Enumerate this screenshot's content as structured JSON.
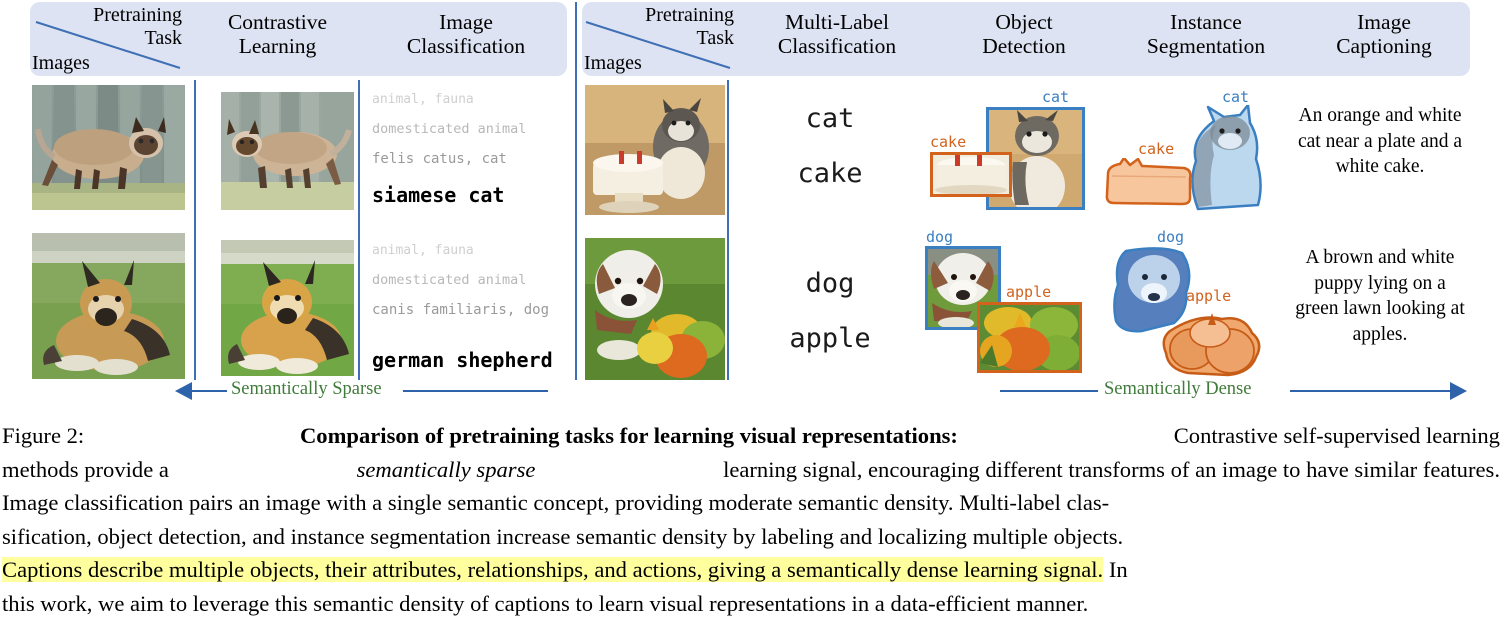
{
  "figure": {
    "label": "Figure 2:",
    "headers": {
      "left_panel": {
        "corner": {
          "task": "Pretraining Task",
          "task_l1": "Pretraining",
          "task_l2": "Task",
          "images": "Images"
        },
        "columns": [
          {
            "l1": "Contrastive",
            "l2": "Learning"
          },
          {
            "l1": "Image",
            "l2": "Classification"
          }
        ]
      },
      "right_panel": {
        "corner": {
          "task_l1": "Pretraining",
          "task_l2": "Task",
          "images": "Images"
        },
        "columns": [
          {
            "l1": "Multi-Label",
            "l2": "Classification"
          },
          {
            "l1": "Object",
            "l2": "Detection"
          },
          {
            "l1": "Instance",
            "l2": "Segmentation"
          },
          {
            "l1": "Image",
            "l2": "Captioning"
          }
        ]
      }
    },
    "rows": [
      {
        "id": "cat-row",
        "image_classification": {
          "hierarchy": [
            "animal, fauna",
            "domesticated animal",
            "felis catus, cat"
          ],
          "final_label": "siamese cat"
        },
        "multi_label": [
          "cat",
          "cake"
        ],
        "detection": [
          {
            "label": "cat",
            "color": "#3a7fc1"
          },
          {
            "label": "cake",
            "color": "#d2621c"
          }
        ],
        "segmentation": [
          {
            "label": "cat",
            "color": "#3a7fc1"
          },
          {
            "label": "cake",
            "color": "#d2621c"
          }
        ],
        "caption": "An orange and white cat near a plate and a white cake."
      },
      {
        "id": "dog-row",
        "image_classification": {
          "hierarchy": [
            "animal, fauna",
            "domesticated animal",
            "canis familiaris, dog"
          ],
          "final_label": "german shepherd"
        },
        "multi_label": [
          "dog",
          "apple"
        ],
        "detection": [
          {
            "label": "dog",
            "color": "#3a7fc1"
          },
          {
            "label": "apple",
            "color": "#d2621c"
          }
        ],
        "segmentation": [
          {
            "label": "dog",
            "color": "#3a7fc1"
          },
          {
            "label": "apple",
            "color": "#d2621c"
          }
        ],
        "caption": "A brown and white puppy lying on a green lawn looking at apples."
      }
    ],
    "axis": {
      "sparse_label": "Semantically Sparse",
      "dense_label": "Semantically Dense"
    },
    "caption_text": {
      "line1_pre": "Figure 2:",
      "line1_bold": "Comparison of pretraining tasks for learning visual representations:",
      "line1_rest": "Contrastive self-supervised learning",
      "line2_a": "methods provide a",
      "line2_italic": "semantically sparse",
      "line2_b": "learning signal, encouraging different transforms of an image to have similar features.",
      "line3": "Image classification pairs an image with a single semantic concept, providing moderate semantic density. Multi-label clas-",
      "line4": "sification, object detection, and instance segmentation increase semantic density by labeling and localizing multiple objects.",
      "line5_hl": "Captions describe multiple objects, their attributes, relationships, and actions, giving a semantically dense learning signal.",
      "line5_tail": "In",
      "line6": "this work, we aim to leverage this semantic density of captions to learn visual representations in a data-efficient manner."
    },
    "colors": {
      "panel_bg": "#dde3f2",
      "arrow_blue": "#2e63ab",
      "axis_green": "#3f7b3a",
      "detect_blue": "#3a7fc1",
      "detect_orange": "#d2621c",
      "highlight_yellow": "#ffff9e"
    }
  }
}
